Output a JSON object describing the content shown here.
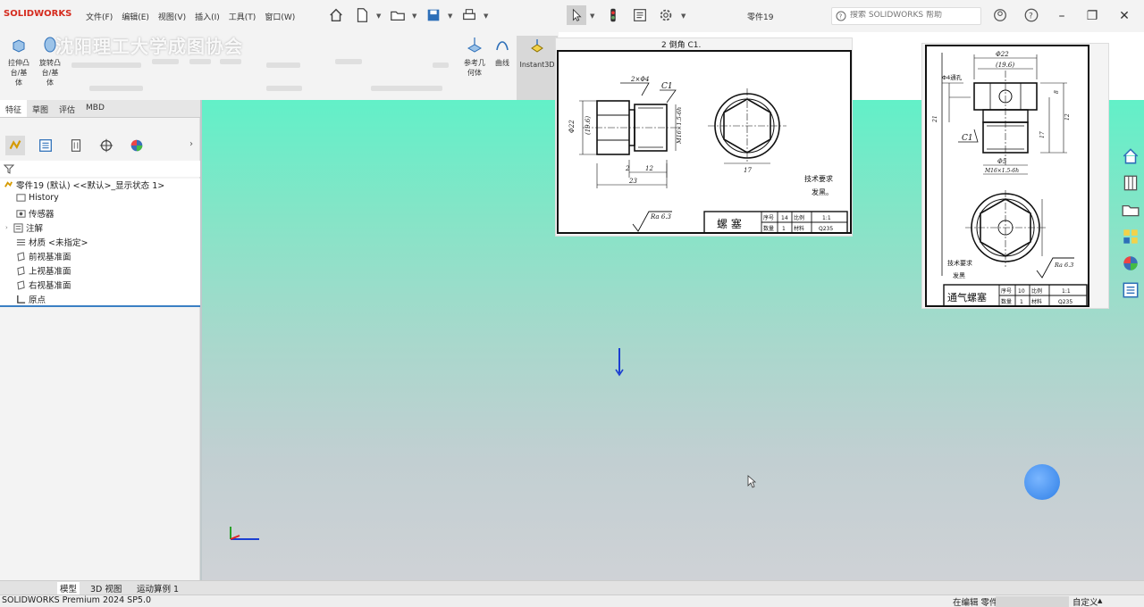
{
  "app": {
    "brand": "SOLIDWORKS",
    "document_title": "零件19",
    "watermark": "沈阳理工大学成图协会"
  },
  "menu": [
    "文件(F)",
    "编辑(E)",
    "视图(V)",
    "插入(I)",
    "工具(T)",
    "窗口(W)"
  ],
  "search": {
    "placeholder": "搜索 SOLIDWORKS 帮助"
  },
  "command_manager": {
    "items": [
      {
        "label": "拉伸凸\n台/基\n体",
        "icon": "extrude-boss-icon"
      },
      {
        "label": "旋转凸\n台/基\n体",
        "icon": "revolve-boss-icon"
      },
      {
        "label": "参考几\n何体",
        "icon": "reference-geometry-icon"
      },
      {
        "label": "曲线",
        "icon": "curves-icon"
      },
      {
        "label": "Instant3D",
        "icon": "instant3d-icon"
      }
    ]
  },
  "tabs": [
    {
      "label": "特征",
      "active": true
    },
    {
      "label": "草图",
      "active": false
    },
    {
      "label": "评估",
      "active": false
    },
    {
      "label": "MBD",
      "active": false
    }
  ],
  "feature_tree": {
    "root": "零件19 (默认) <<默认>_显示状态 1>",
    "items": [
      {
        "label": "History",
        "icon": "history-icon"
      },
      {
        "label": "传感器",
        "icon": "sensor-icon"
      },
      {
        "label": "注解",
        "icon": "annotation-icon"
      },
      {
        "label": "材质 <未指定>",
        "icon": "material-icon"
      },
      {
        "label": "前视基准面",
        "icon": "plane-icon"
      },
      {
        "label": "上视基准面",
        "icon": "plane-icon"
      },
      {
        "label": "右视基准面",
        "icon": "plane-icon"
      },
      {
        "label": "原点",
        "icon": "origin-icon"
      }
    ]
  },
  "drawing1": {
    "header": "2  倒角 C1.",
    "title": "螺  塞",
    "tech_req": "技术要求",
    "tech_req_line": "发黑。",
    "roughness": "Ra 6.3",
    "table": [
      "序号",
      "14",
      "比例",
      "1:1",
      "数量",
      "1",
      "材料",
      "Q235"
    ],
    "dims": [
      "2×Φ4",
      "C1",
      "Φ22",
      "(19.6)",
      "M16×1.5-6h",
      "2",
      "12",
      "23",
      "17"
    ]
  },
  "drawing2": {
    "title": "通气螺塞",
    "tech_req": "技术要求",
    "tech_req_line": "发黑",
    "roughness": "Ra 6.3",
    "table": [
      "序号",
      "10",
      "比例",
      "1:1",
      "数量",
      "1",
      "材料",
      "Q235"
    ],
    "dims": [
      "Φ22",
      "(19.6)",
      "Φ4通孔",
      "Φ5",
      "C1",
      "M16×1.5-6h",
      "17",
      "21",
      "8",
      "12"
    ]
  },
  "bottom_tabs": [
    "模型",
    "3D 视图",
    "运动算例 1"
  ],
  "status": {
    "left": "SOLIDWORKS Premium 2024 SP5.0",
    "editing": "在编辑 零件",
    "custom": "自定义"
  },
  "colors": {
    "accent": "#3b80c4",
    "viewport_top": "#62f0c8",
    "viewport_bottom": "#cfd2d6",
    "brand": "#d52b1e"
  }
}
